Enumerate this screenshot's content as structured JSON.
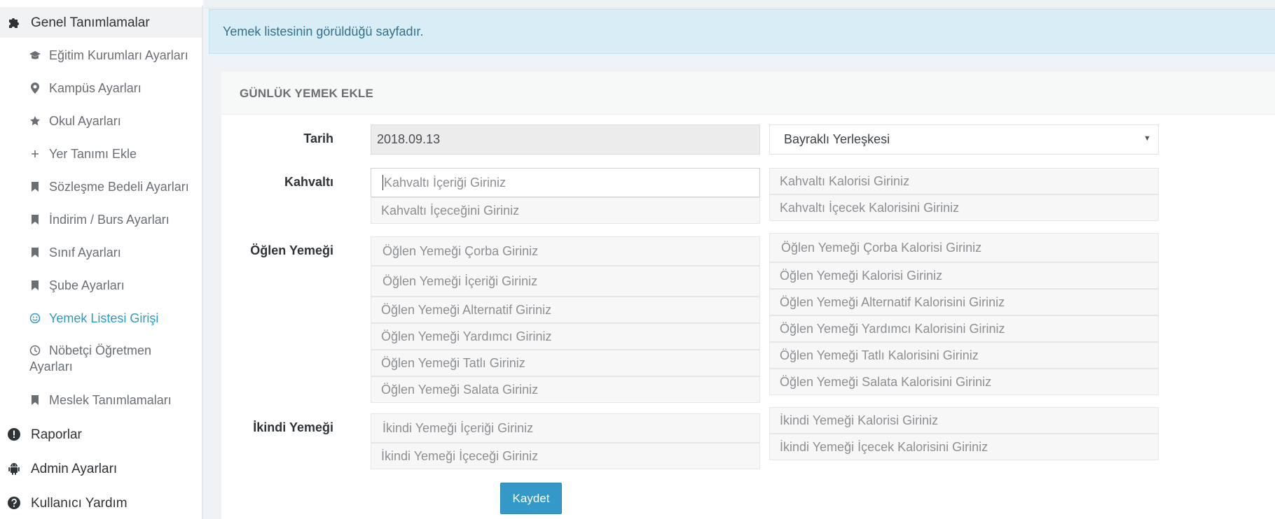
{
  "sidebar": {
    "items": [
      {
        "label": "Genel Tanımlamalar",
        "icon": "puzzle-icon"
      },
      {
        "label": "Eğitim Kurumları Ayarları",
        "icon": "graduation-cap-icon"
      },
      {
        "label": "Kampüs Ayarları",
        "icon": "map-marker-icon"
      },
      {
        "label": "Okul Ayarları",
        "icon": "star-icon"
      },
      {
        "label": "Yer Tanımı Ekle",
        "icon": "plus-icon"
      },
      {
        "label": "Sözleşme Bedeli Ayarları",
        "icon": "bookmark-icon"
      },
      {
        "label": "İndirim / Burs Ayarları",
        "icon": "bookmark-icon"
      },
      {
        "label": "Sınıf Ayarları",
        "icon": "bookmark-icon"
      },
      {
        "label": "Şube Ayarları",
        "icon": "bookmark-icon"
      },
      {
        "label": "Yemek Listesi Girişi",
        "icon": "smile-icon"
      },
      {
        "label_line1": "Nöbetçi Öğretmen",
        "label_line2": "Ayarları",
        "icon": "clock-icon"
      },
      {
        "label": "Meslek Tanımlamaları",
        "icon": "bookmark-icon"
      },
      {
        "label": "Raporlar",
        "icon": "exclamation-circle-icon"
      },
      {
        "label": "Admin Ayarları",
        "icon": "android-icon"
      },
      {
        "label": "Kullanıcı Yardım",
        "icon": "question-circle-icon"
      }
    ]
  },
  "info": {
    "text": "Yemek listesinin görüldüğü sayfadır."
  },
  "panel": {
    "title": "GÜNLÜK YEMEK EKLE"
  },
  "form": {
    "date_label": "Tarih",
    "date_value": "2018.09.13",
    "campus_selected": "Bayraklı Yerleşkesi",
    "breakfast": {
      "label": "Kahvaltı",
      "content_placeholder": "Kahvaltı İçeriği Giriniz",
      "drink_placeholder": "Kahvaltı İçeceğini Giriniz",
      "calorie_placeholder": "Kahvaltı Kalorisi Giriniz",
      "drink_calorie_placeholder": "Kahvaltı İçecek Kalorisini Giriniz"
    },
    "lunch": {
      "label": "Öğlen Yemeği",
      "soup_placeholder": "Öğlen Yemeği Çorba Giriniz",
      "content_placeholder": "Öğlen Yemeği İçeriği Giriniz",
      "alt_placeholder": "Öğlen Yemeği Alternatif Giriniz",
      "side_placeholder": "Öğlen Yemeği Yardımcı Giriniz",
      "dessert_placeholder": "Öğlen Yemeği Tatlı Giriniz",
      "salad_placeholder": "Öğlen Yemeği Salata Giriniz",
      "soup_cal_placeholder": "Öğlen Yemeği Çorba Kalorisi Giriniz",
      "cal_placeholder": "Öğlen Yemeği Kalorisi Giriniz",
      "alt_cal_placeholder": "Öğlen Yemeği Alternatif Kalorisini Giriniz",
      "side_cal_placeholder": "Öğlen Yemeği Yardımcı Kalorisini Giriniz",
      "dessert_cal_placeholder": "Öğlen Yemeği Tatlı Kalorisini Giriniz",
      "salad_cal_placeholder": "Öğlen Yemeği Salata Kalorisini Giriniz"
    },
    "afternoon": {
      "label": "İkindi Yemeği",
      "content_placeholder": "İkindi Yemeği İçeriği Giriniz",
      "drink_placeholder": "İkindi Yemeği İçeceği Giriniz",
      "cal_placeholder": "İkindi Yemeği Kalorisi Giriniz",
      "drink_cal_placeholder": "İkindi Yemeği İçecek Kalorisini Giriniz"
    },
    "save_label": "Kaydet"
  },
  "colors": {
    "accent": "#3498c8",
    "info_bg": "#d9edf7",
    "info_text": "#31708f",
    "active_link": "#2a9ac6"
  }
}
